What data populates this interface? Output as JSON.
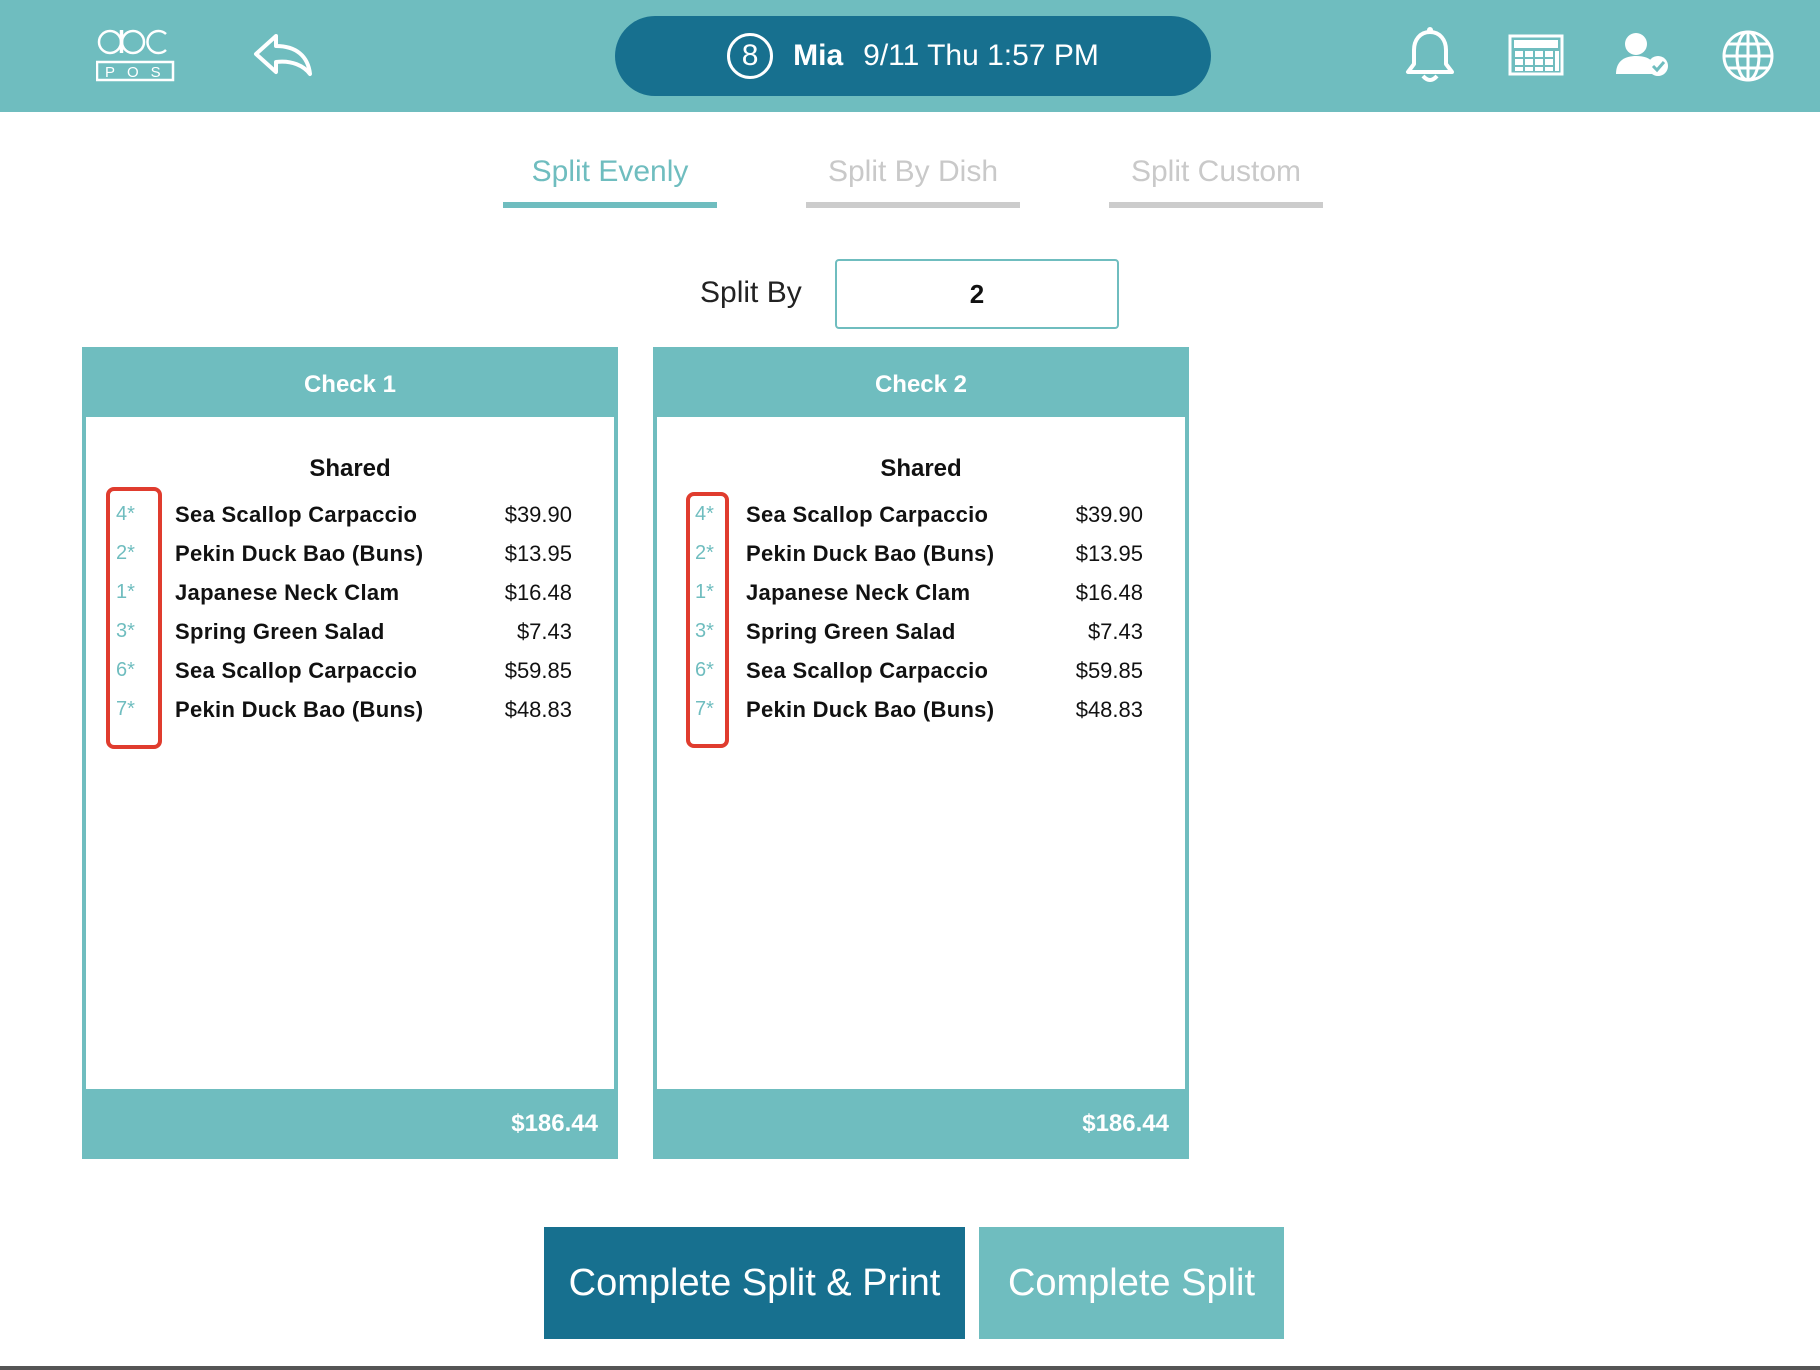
{
  "header": {
    "logo_text": "abc",
    "logo_sub": "POS",
    "seat_number": "8",
    "user_name": "Mia",
    "datetime": "9/11 Thu 1:57 PM",
    "icons": [
      "logo-icon",
      "back-icon",
      "bell-icon",
      "calculator-icon",
      "user-check-icon",
      "globe-icon"
    ]
  },
  "tabs": [
    {
      "label": "Split Evenly",
      "active": true
    },
    {
      "label": "Split By Dish",
      "active": false
    },
    {
      "label": "Split Custom",
      "active": false
    }
  ],
  "split": {
    "label": "Split By",
    "value": "2"
  },
  "checks": [
    {
      "title": "Check 1",
      "section": "Shared",
      "items": [
        {
          "qty": "4*",
          "name": "Sea Scallop Carpaccio",
          "price": "$39.90"
        },
        {
          "qty": "2*",
          "name": "Pekin Duck Bao (Buns)",
          "price": "$13.95"
        },
        {
          "qty": "1*",
          "name": "Japanese Neck Clam",
          "price": "$16.48"
        },
        {
          "qty": "3*",
          "name": "Spring Green Salad",
          "price": "$7.43"
        },
        {
          "qty": "6*",
          "name": "Sea Scallop Carpaccio",
          "price": "$59.85"
        },
        {
          "qty": "7*",
          "name": "Pekin Duck Bao (Buns)",
          "price": "$48.83"
        }
      ],
      "total": "$186.44"
    },
    {
      "title": "Check 2",
      "section": "Shared",
      "items": [
        {
          "qty": "4*",
          "name": "Sea Scallop Carpaccio",
          "price": "$39.90"
        },
        {
          "qty": "2*",
          "name": "Pekin Duck Bao (Buns)",
          "price": "$13.95"
        },
        {
          "qty": "1*",
          "name": "Japanese Neck Clam",
          "price": "$16.48"
        },
        {
          "qty": "3*",
          "name": "Spring Green Salad",
          "price": "$7.43"
        },
        {
          "qty": "6*",
          "name": "Sea Scallop Carpaccio",
          "price": "$59.85"
        },
        {
          "qty": "7*",
          "name": "Pekin Duck Bao (Buns)",
          "price": "$48.83"
        }
      ],
      "total": "$186.44"
    }
  ],
  "buttons": {
    "print_label": "Complete Split & Print",
    "complete_label": "Complete Split"
  },
  "colors": {
    "teal": "#6fbdbf",
    "dark_teal": "#17708f",
    "highlight_red": "#e03c2e"
  }
}
